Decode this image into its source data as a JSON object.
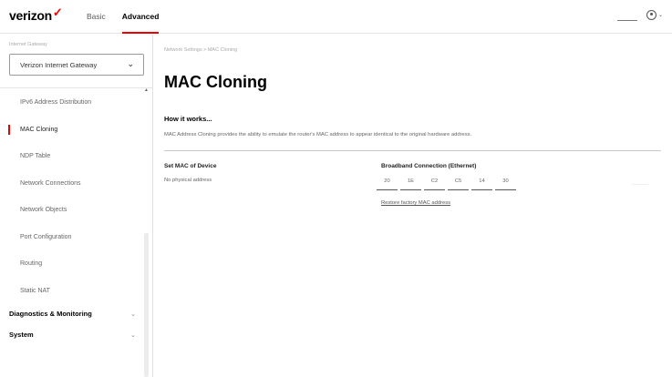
{
  "brand": {
    "name": "verizon",
    "mark": "✓"
  },
  "topnav": {
    "tabs": [
      {
        "label": "Basic"
      },
      {
        "label": "Advanced"
      }
    ]
  },
  "sidebar": {
    "gateway_label": "Internet Gateway",
    "gateway_selected": "Verizon Internet Gateway",
    "items": [
      {
        "label": "IPv6 Address Distribution"
      },
      {
        "label": "MAC Cloning"
      },
      {
        "label": "NDP Table"
      },
      {
        "label": "Network Connections"
      },
      {
        "label": "Network Objects"
      },
      {
        "label": "Port Configuration"
      },
      {
        "label": "Routing"
      },
      {
        "label": "Static NAT"
      }
    ],
    "sections": [
      {
        "label": "Diagnostics & Monitoring"
      },
      {
        "label": "System"
      }
    ]
  },
  "main": {
    "breadcrumb": "Network Settings > MAC Cloning",
    "title": "MAC Cloning",
    "how_title": "How it works...",
    "how_description": "MAC Address Cloning provides the ability to emulate the router's MAC address to appear identical to the original hardware address.",
    "set_mac_label": "Set MAC of Device",
    "physical_address": "No physical address",
    "broadband_label": "Broadband Connection (Ethernet)",
    "mac_octets": [
      "20",
      "1E",
      "C2",
      "C5",
      "14",
      "30"
    ],
    "restore_link": "Restore factory MAC address"
  },
  "colors": {
    "accent": "#ee0000",
    "text": "#000000",
    "muted": "#666666"
  }
}
